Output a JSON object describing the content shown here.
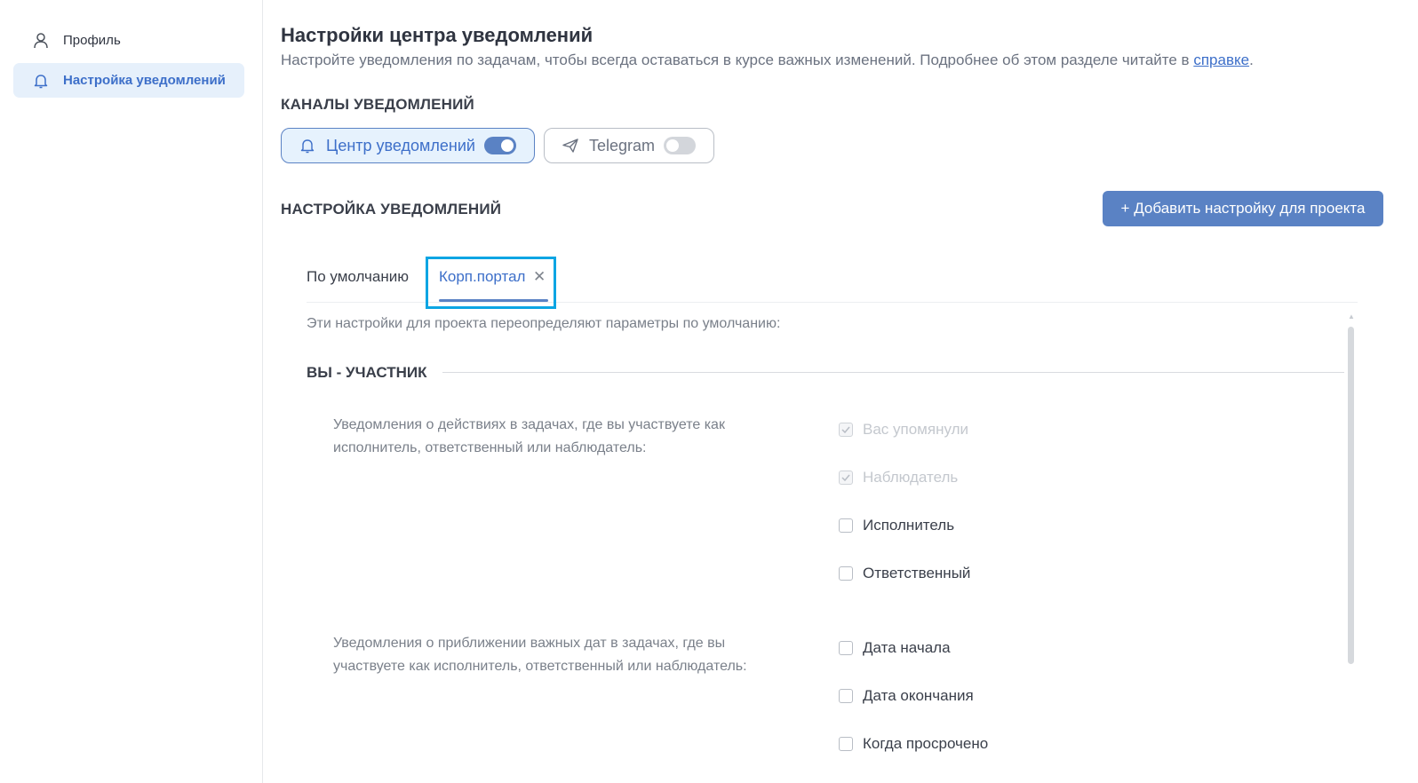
{
  "sidebar": {
    "items": [
      {
        "label": "Профиль",
        "icon": "user-icon"
      },
      {
        "label": "Настройка уведомлений",
        "icon": "bell-icon"
      }
    ]
  },
  "header": {
    "title": "Настройки центра уведомлений",
    "subtitle": "Настройте уведомления по задачам, чтобы всегда оставаться в курсе важных изменений. Подробнее об этом разделе читайте в ",
    "help_link": "справке",
    "subtitle_end": "."
  },
  "channels": {
    "heading": "КАНАЛЫ УВЕДОМЛЕНИЙ",
    "items": [
      {
        "label": "Центр уведомлений",
        "icon": "bell-icon",
        "enabled": true
      },
      {
        "label": "Telegram",
        "icon": "paper-plane-icon",
        "enabled": false
      }
    ]
  },
  "settings": {
    "heading": "НАСТРОЙКА УВЕДОМЛЕНИЙ",
    "add_button": "+ Добавить настройку для проекта",
    "tabs": [
      {
        "label": "По умолчанию"
      },
      {
        "label": "Корп.портал",
        "close": "✕"
      }
    ],
    "note": "Эти настройки для проекта переопределяют параметры по умолчанию:",
    "group_title": "ВЫ - УЧАСТНИК",
    "groups": [
      {
        "description": "Уведомления о действиях в задачах, где вы участвуете как исполнитель, ответственный или наблюдатель:",
        "options": [
          {
            "label": "Вас упомянули",
            "checked": true,
            "disabled": true
          },
          {
            "label": "Наблюдатель",
            "checked": true,
            "disabled": true
          },
          {
            "label": "Исполнитель",
            "checked": false,
            "disabled": false
          },
          {
            "label": "Ответственный",
            "checked": false,
            "disabled": false
          }
        ]
      },
      {
        "description": "Уведомления о приближении важных дат в задачах, где вы участвуете как исполнитель, ответственный или наблюдатель:",
        "options": [
          {
            "label": "Дата начала",
            "checked": false,
            "disabled": false
          },
          {
            "label": "Дата окончания",
            "checked": false,
            "disabled": false
          },
          {
            "label": "Когда просрочено",
            "checked": false,
            "disabled": false
          }
        ]
      }
    ]
  },
  "colors": {
    "accent": "#5a82c4",
    "accent_text": "#3d6fc9",
    "highlight_box": "#0ba5e3",
    "active_bg": "#e6f0fb"
  }
}
